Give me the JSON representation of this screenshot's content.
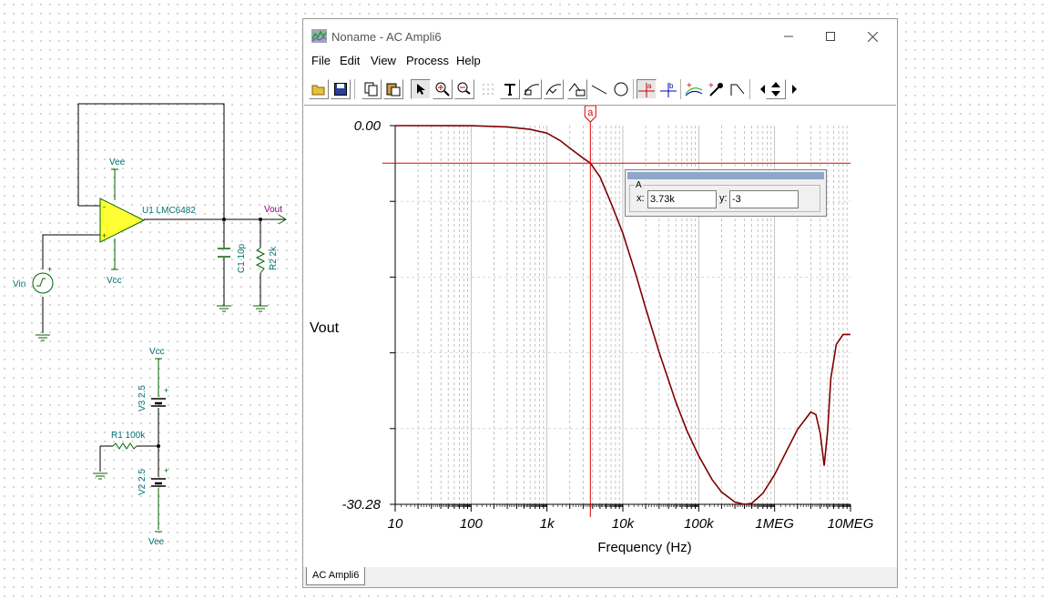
{
  "schematic": {
    "vee_top": "Vee",
    "opamp_label": "U1 LMC6482",
    "vout_label": "Vout",
    "c1_label": "C1 10p",
    "r2_label": "R2 2k",
    "vcc_bottom_opamp": "Vcc",
    "vin_label": "Vin",
    "vcc_supply": "Vcc",
    "v3_label": "V3 2.5",
    "r1_label": "R1 100k",
    "v2_label": "V2 2.5",
    "vee_supply": "Vee",
    "plus_sign": "+",
    "minus_sign": "-"
  },
  "window": {
    "title": "Noname - AC Ampli6",
    "menu": [
      "File",
      "Edit",
      "View",
      "Process",
      "Help"
    ],
    "toolbar_icons": [
      "open-icon",
      "save-icon",
      "copy-icon",
      "paste-icon",
      "pointer-icon",
      "zoom-in-icon",
      "zoom-100-icon",
      "grid-icon",
      "text-icon",
      "curve-label-icon",
      "curve-label-2-icon",
      "wave-label-icon",
      "line-icon",
      "circle-icon",
      "cursor-a-icon",
      "cursor-b-icon",
      "add-curve-icon",
      "probe-icon",
      "step-icon",
      "arrow-left-icon",
      "arrow-updown-icon",
      "arrow-right-icon"
    ],
    "status_tab": "AC Ampli6"
  },
  "cursor": {
    "legend": "A",
    "x_label": "x:",
    "y_label": "y:",
    "x_value": "3.73k",
    "y_value": "-3",
    "marker": "a"
  },
  "chart_data": {
    "type": "line",
    "ylabel": "Vout",
    "xlabel": "Frequency (Hz)",
    "xscale": "log",
    "xlim": [
      10,
      10000000
    ],
    "ylim": [
      -30.28,
      0.0
    ],
    "y_tick_labels": [
      "0.00",
      "-30.28"
    ],
    "x_tick_labels": [
      "10",
      "100",
      "1k",
      "10k",
      "100k",
      "1MEG",
      "10MEG"
    ],
    "x_ticks": [
      10,
      100,
      1000,
      10000,
      100000,
      1000000,
      10000000
    ],
    "grid": true,
    "series": [
      {
        "color": "#800000",
        "x": [
          10,
          100,
          300,
          600,
          1000,
          1500,
          2000,
          3000,
          3730,
          5000,
          7000,
          10000,
          15000,
          20000,
          30000,
          50000,
          70000,
          100000,
          150000,
          200000,
          300000,
          400000,
          500000,
          700000,
          1000000,
          1500000,
          2000000,
          3000000,
          3500000,
          4000000,
          4500000,
          5000000,
          5500000,
          6500000,
          8000000,
          10000000
        ],
        "y": [
          0,
          -0.01,
          -0.1,
          -0.3,
          -0.6,
          -1.2,
          -1.8,
          -2.6,
          -3.0,
          -4.1,
          -6.2,
          -8.6,
          -12.0,
          -14.6,
          -18.1,
          -22.1,
          -24.4,
          -26.4,
          -28.3,
          -29.3,
          -30.1,
          -30.28,
          -30.2,
          -29.4,
          -27.9,
          -25.8,
          -24.3,
          -22.9,
          -23.1,
          -24.6,
          -27.2,
          -24.4,
          -20.2,
          -17.5,
          -16.7,
          -16.7
        ]
      }
    ],
    "cursor_x": 3730,
    "cursor_y": -3
  }
}
